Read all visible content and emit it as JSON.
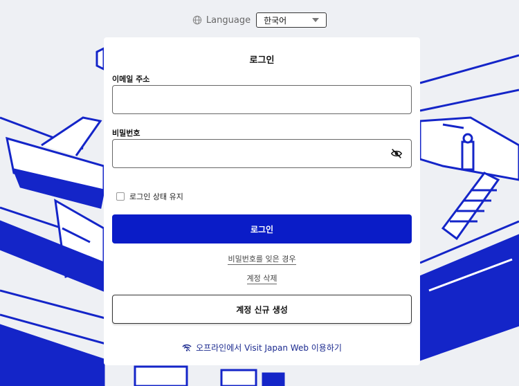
{
  "language": {
    "label": "Language",
    "selected": "한국어"
  },
  "login": {
    "title": "로그인",
    "email_label": "이메일 주소",
    "email_value": "",
    "password_label": "비밀번호",
    "password_value": "",
    "remember_label": "로그인 상태 유지",
    "submit_label": "로그인",
    "forgot_label": "비밀번호를 잊은 경우",
    "delete_label": "계정 삭제",
    "create_label": "계정 신규 생성",
    "offline_label": "오프라인에서 Visit Japan Web 이용하기"
  },
  "colors": {
    "primary": "#0a1cc7",
    "illustration": "#1425c8",
    "background": "#eef0f4"
  },
  "icons": [
    "globe-icon",
    "chevron-down-icon",
    "eye-slash-icon",
    "wifi-icon"
  ]
}
